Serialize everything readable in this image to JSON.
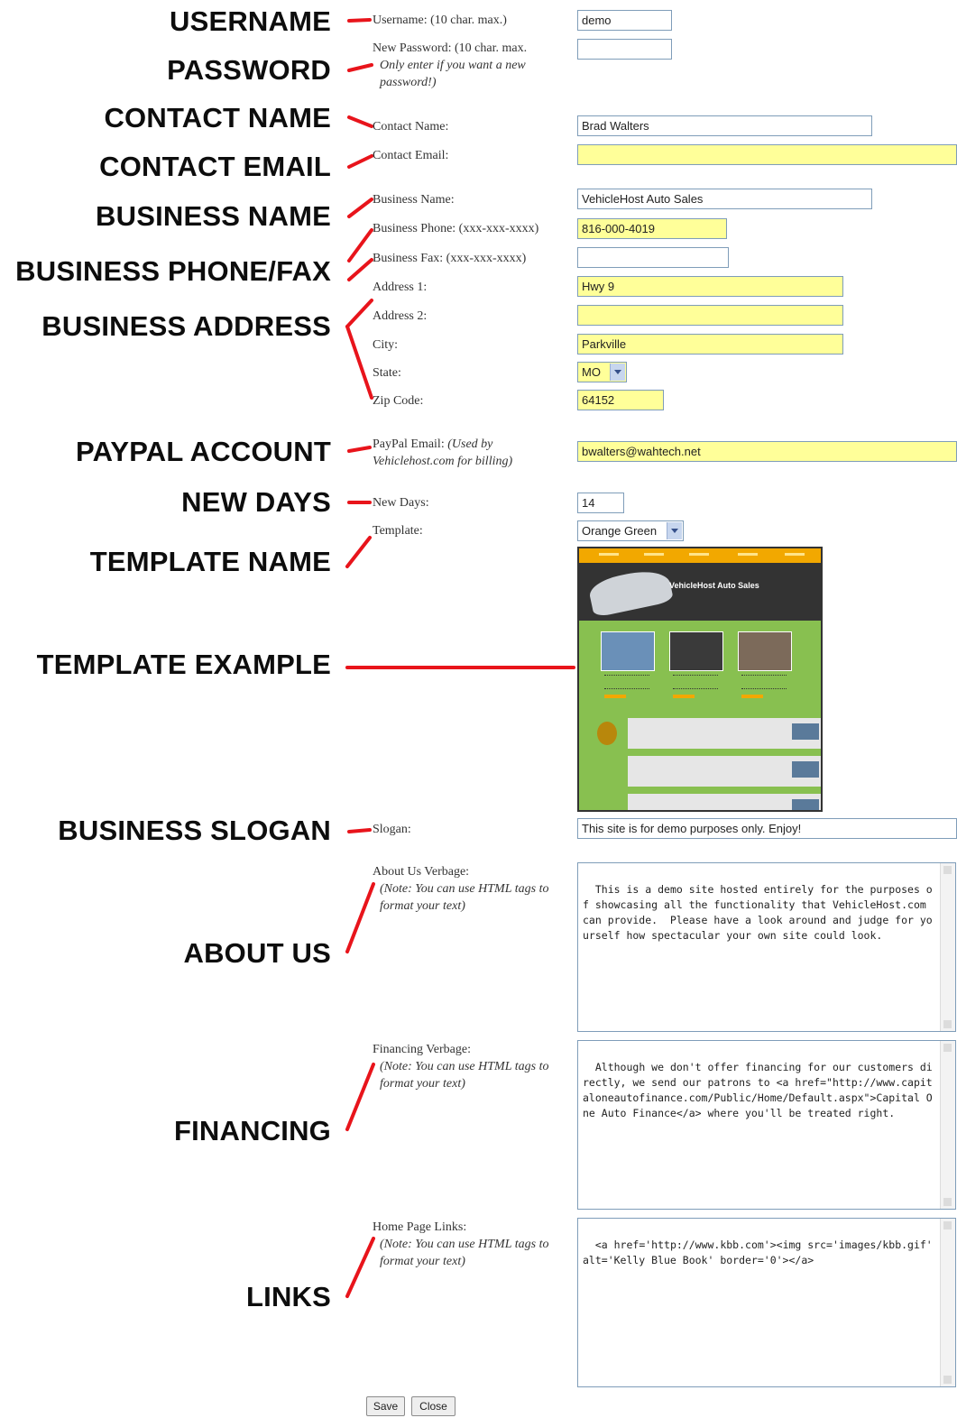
{
  "callouts": {
    "username": "USERNAME",
    "password": "PASSWORD",
    "contact_name": "CONTACT NAME",
    "contact_email": "CONTACT EMAIL",
    "business_name": "BUSINESS NAME",
    "business_phone_fax": "BUSINESS PHONE/FAX",
    "business_address": "BUSINESS ADDRESS",
    "paypal_account": "PAYPAL ACCOUNT",
    "new_days": "NEW DAYS",
    "template_name": "TEMPLATE NAME",
    "template_example": "TEMPLATE EXAMPLE",
    "business_slogan": "BUSINESS SLOGAN",
    "about_us": "ABOUT US",
    "financing": "FINANCING",
    "links": "LINKS"
  },
  "form": {
    "username": {
      "label": "Username: (10 char. max.)",
      "value": "demo"
    },
    "password": {
      "label": "New Password: (10 char. max.",
      "note": "Only enter if you want a new password!)",
      "value": ""
    },
    "contact_name": {
      "label": "Contact Name:",
      "value": "Brad Walters"
    },
    "contact_email": {
      "label": "Contact Email:",
      "value": ""
    },
    "business_name": {
      "label": "Business Name:",
      "value": "VehicleHost Auto Sales"
    },
    "business_phone": {
      "label": "Business Phone: (xxx-xxx-xxxx)",
      "value": "816-000-4019"
    },
    "business_fax": {
      "label": "Business Fax: (xxx-xxx-xxxx)",
      "value": ""
    },
    "address1": {
      "label": "Address 1:",
      "value": "Hwy 9"
    },
    "address2": {
      "label": "Address 2:",
      "value": ""
    },
    "city": {
      "label": "City:",
      "value": "Parkville"
    },
    "state": {
      "label": "State:",
      "value": "MO"
    },
    "zip": {
      "label": "Zip Code:",
      "value": "64152"
    },
    "paypal": {
      "label": "PayPal Email:",
      "note": "(Used by Vehiclehost.com for billing)",
      "value": "bwalters@wahtech.net"
    },
    "new_days": {
      "label": "New Days:",
      "value": "14"
    },
    "template": {
      "label": "Template:",
      "value": "Orange Green"
    },
    "template_preview": {
      "title": "VehicleHost Auto Sales"
    },
    "slogan": {
      "label": "Slogan:",
      "value": "This site is for demo purposes only.  Enjoy!"
    },
    "about": {
      "label": "About Us Verbage:",
      "note": "(Note: You can use HTML tags to format your text)",
      "value": "This is a demo site hosted entirely for the purposes of showcasing all the functionality that VehicleHost.com can provide.  Please have a look around and judge for yourself how spectacular your own site could look."
    },
    "financing": {
      "label": "Financing Verbage:",
      "note": "(Note: You can use HTML tags to format your text)",
      "value": "Although we don't offer financing for our customers directly, we send our patrons to <a href=\"http://www.capitaloneautofinance.com/Public/Home/Default.aspx\">Capital One Auto Finance</a> where you'll be treated right."
    },
    "links": {
      "label": "Home Page Links:",
      "note": "(Note: You can use HTML tags to format your text)",
      "value": "<a href='http://www.kbb.com'><img src='images/kbb.gif' alt='Kelly Blue Book' border='0'></a>"
    }
  },
  "buttons": {
    "save": "Save",
    "close": "Close"
  },
  "colors": {
    "required_field": "#ffff99",
    "callout_line": "#e8141b",
    "input_border": "#7f9db9"
  }
}
